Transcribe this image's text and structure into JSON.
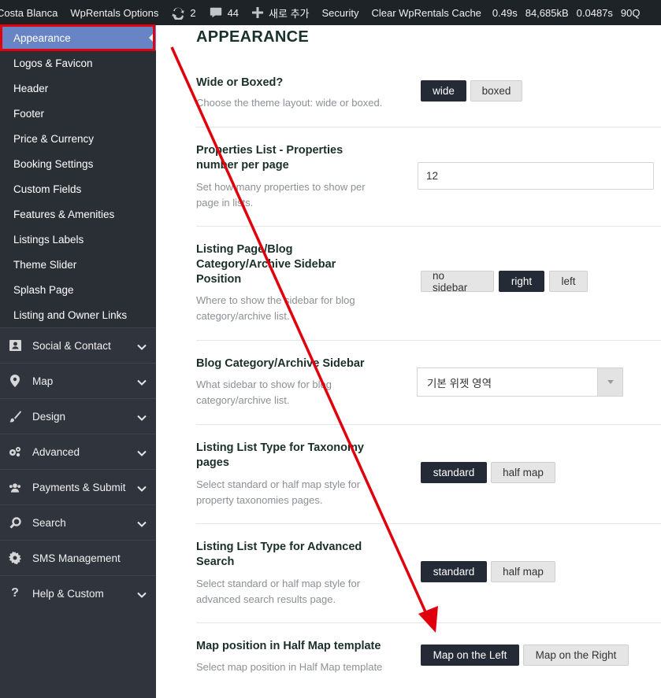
{
  "adminbar": {
    "site_name": "Costa Blanca",
    "theme_options": "WpRentals Options",
    "updates_count": "2",
    "comments_count": "44",
    "new_label": "새로 추가",
    "security": "Security",
    "clear_cache": "Clear WpRentals Cache",
    "stat_time": "0.49s",
    "stat_mem": "84,685kB",
    "stat_query_time": "0.0487s",
    "stat_queries": "90Q"
  },
  "sidebar": {
    "sub_items": [
      "Appearance",
      "Logos & Favicon",
      "Header",
      "Footer",
      "Price & Currency",
      "Booking Settings",
      "Custom Fields",
      "Features & Amenities",
      "Listings Labels",
      "Theme Slider",
      "Splash Page",
      "Listing and Owner Links"
    ],
    "groups": [
      {
        "label": "Social & Contact",
        "icon": "contact-card-icon"
      },
      {
        "label": "Map",
        "icon": "map-pin-icon"
      },
      {
        "label": "Design",
        "icon": "brush-icon"
      },
      {
        "label": "Advanced",
        "icon": "cogs-icon"
      },
      {
        "label": "Payments & Submit",
        "icon": "users-icon"
      },
      {
        "label": "Search",
        "icon": "search-icon"
      },
      {
        "label": "SMS Management",
        "icon": "gear-icon"
      },
      {
        "label": "Help & Custom",
        "icon": "question-icon"
      }
    ]
  },
  "main": {
    "title": "APPEARANCE",
    "options": [
      {
        "title": "Wide or Boxed?",
        "desc": "Choose the theme layout: wide or boxed.",
        "buttons": [
          "wide",
          "boxed"
        ],
        "selected": "wide"
      },
      {
        "title": "Properties List - Properties number per page",
        "desc": "Set how many properties to show per page in lists.",
        "input_value": "12"
      },
      {
        "title": "Listing Page/Blog Category/Archive Sidebar Position",
        "desc": "Where to show the sidebar for blog category/archive list.",
        "buttons": [
          "no sidebar",
          "right",
          "left"
        ],
        "selected": "right"
      },
      {
        "title": "Blog Category/Archive Sidebar",
        "desc": "What sidebar to show for blog category/archive list.",
        "select_value": "기본 위젯 영역"
      },
      {
        "title": "Listing List Type for Taxonomy pages",
        "desc": "Select standard or half map style for property taxonomies pages.",
        "buttons": [
          "standard",
          "half map"
        ],
        "selected": "standard"
      },
      {
        "title": "Listing List Type for Advanced Search",
        "desc": "Select standard or half map style for advanced search results page.",
        "buttons": [
          "standard",
          "half map"
        ],
        "selected": "standard"
      },
      {
        "title": "Map position in Half Map template",
        "desc": "Select map position in Half Map template",
        "buttons": [
          "Map on the Left",
          "Map on the Right"
        ],
        "selected": "Map on the Left"
      }
    ]
  },
  "colors": {
    "adminbar_bg": "#1d2327",
    "sidebar_bg": "#30353d",
    "active_item_bg": "#6984c4",
    "highlight_red": "#e0000d",
    "button_selected": "#242b36",
    "button_unselected": "#e5e5e5"
  }
}
